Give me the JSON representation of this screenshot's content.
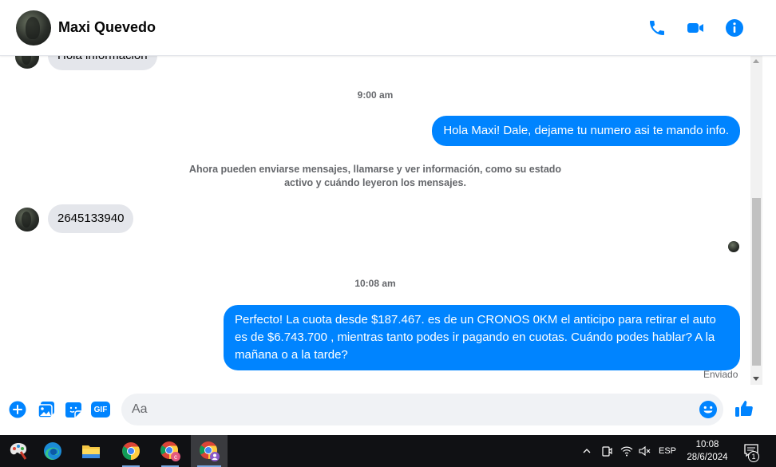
{
  "header": {
    "contact_name": "Maxi Quevedo",
    "icons": [
      "phone-icon",
      "video-icon",
      "info-icon"
    ],
    "accent_color": "#0084ff"
  },
  "conversation": {
    "partial_message": "Hola información",
    "timestamp_1": "9:00 am",
    "outgoing_1": "Hola Maxi! Dale, dejame tu numero asi te mando info.",
    "notice": "Ahora pueden enviarse mensajes, llamarse y ver información, como su estado activo y cuándo leyeron los mensajes.",
    "incoming_1": "2645133940",
    "timestamp_2": "10:08 am",
    "outgoing_2": "Perfecto! La cuota desde $187.467. es de un CRONOS 0KM el anticipo para retirar el auto es de $6.743.700 , mientras tanto podes ir pagando en cuotas. Cuándo podes hablar? A la mañana o a la tarde?",
    "status": "Enviado"
  },
  "composer": {
    "placeholder": "Aa",
    "icons": [
      "plus-icon",
      "image-icon",
      "sticker-icon",
      "gif-icon",
      "emoji-icon",
      "like-icon"
    ],
    "gif_label": "GIF"
  },
  "taskbar": {
    "apps": [
      "paint-app",
      "edge-app",
      "file-explorer-app",
      "chrome-app",
      "chrome-profile-c-app",
      "chrome-profile-active-app"
    ],
    "tray": {
      "language": "ESP",
      "time": "10:08",
      "date": "28/6/2024",
      "notifications": "1"
    }
  }
}
